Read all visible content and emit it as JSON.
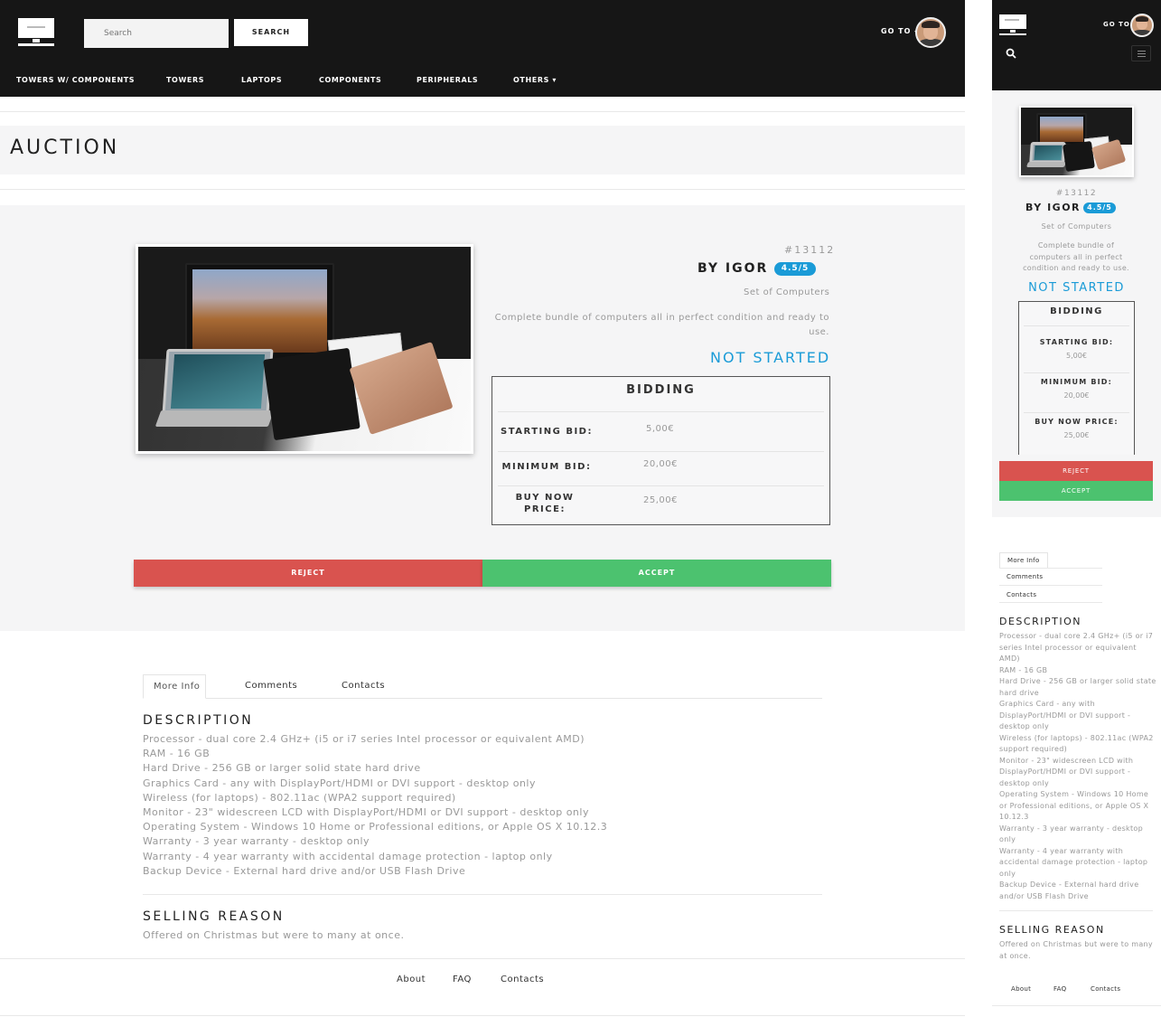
{
  "header": {
    "search_placeholder": "Search",
    "search_button": "SEARCH",
    "goto_label": "GO TO",
    "goto_caret": "▾"
  },
  "nav": {
    "items": [
      "TOWERS W/ COMPONENTS",
      "TOWERS",
      "LAPTOPS",
      "COMPONENTS",
      "PERIPHERALS",
      "OTHERS ▾"
    ]
  },
  "page": {
    "title": "AUCTION"
  },
  "product": {
    "id": "#13112",
    "seller": "BY IGOR",
    "rating": "4.5/5",
    "category": "Set of Computers",
    "description": "Complete bundle of computers all in perfect condition and ready to use.",
    "status": "NOT STARTED"
  },
  "bidding": {
    "title": "BIDDING",
    "starting_label": "STARTING BID:",
    "starting_value": "5,00€",
    "minimum_label": "MINIMUM BID:",
    "minimum_value": "20,00€",
    "buynow_label": "BUY NOW PRICE:",
    "buynow_label_line1": "BUY NOW",
    "buynow_label_line2": "PRICE:",
    "buynow_value": "25,00€"
  },
  "actions": {
    "reject": "REJECT",
    "accept": "ACCEPT"
  },
  "tabs": [
    "More Info",
    "Comments",
    "Contacts"
  ],
  "description": {
    "title": "DESCRIPTION",
    "items": [
      "Processor - dual core 2.4 GHz+ (i5 or i7 series Intel processor or equivalent AMD)",
      "RAM - 16 GB",
      "Hard Drive - 256 GB or larger solid state hard drive",
      "Graphics Card - any with DisplayPort/HDMI or DVI support - desktop only",
      "Wireless (for laptops) - 802.11ac (WPA2 support required)",
      "Monitor - 23\" widescreen LCD with DisplayPort/HDMI or DVI support - desktop only",
      "Operating System - Windows 10 Home or Professional editions, or Apple OS X 10.12.3",
      "Warranty - 3 year warranty - desktop only",
      "Warranty - 4 year warranty with accidental damage protection - laptop only",
      "Backup Device - External hard drive and/or USB Flash Drive"
    ]
  },
  "selling_reason": {
    "title": "SELLING REASON",
    "text": "Offered on Christmas but were to many at once."
  },
  "footer": {
    "links": [
      "About",
      "FAQ",
      "Contacts"
    ]
  },
  "colors": {
    "header_bg": "#161616",
    "accent_blue": "#1a9bd7",
    "reject_red": "#d9534f",
    "accept_green": "#4cc26f"
  }
}
